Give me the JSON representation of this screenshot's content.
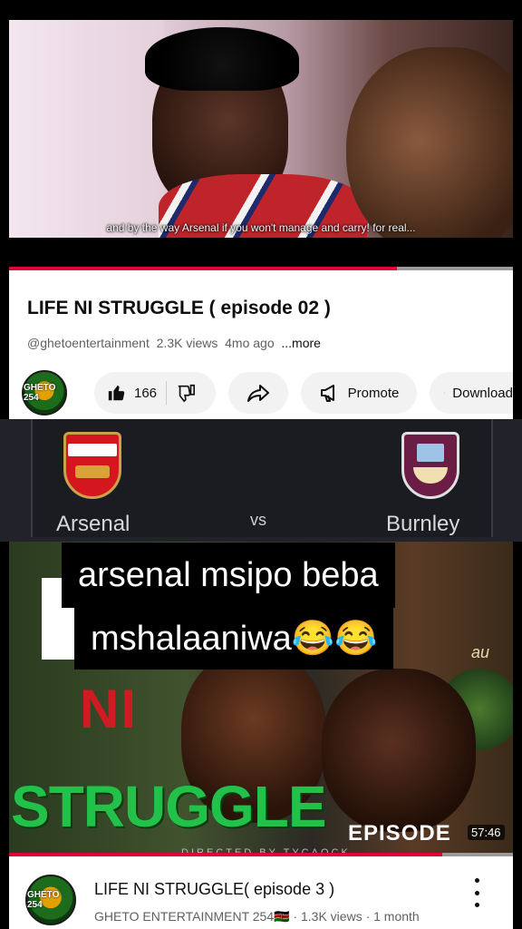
{
  "video_top": {
    "subtitle": "and by the way Arsenal if you won't manage and carry! for real..."
  },
  "video1": {
    "title": "LIFE NI STRUGGLE ( episode 02 )",
    "channel_handle": "@ghetoentertainment",
    "views": "2.3K views",
    "age": "4mo ago",
    "more": "...more",
    "channel_logo_text": "GHETO 254",
    "likes": "166",
    "promote_label": "Promote",
    "download_label": "Download",
    "progress": 0.77
  },
  "scoreboard": {
    "home_team": "Arsenal",
    "vs": "vs",
    "away_team": "Burnley"
  },
  "overlay": {
    "line1": "arsenal msipo beba",
    "line2": "mshalaaniwa😂😂"
  },
  "video2": {
    "thumb_title_l": "L",
    "thumb_title_ni": "NI",
    "thumb_title_struggle": "STRUGGLE",
    "thumb_episode": "EPISODE",
    "thumb_directed": "DIRECTED BY TYCAOCK",
    "thumb_side_text": "au",
    "duration": "57:46",
    "title": "LIFE NI STRUGGLE( episode 3 )",
    "meta": "GHETO ENTERTAINMENT 254🇰🇪 · 1.3K views · 1 month",
    "channel_logo_text": "GHETO 254",
    "progress": 0.86
  },
  "colors": {
    "progress_red": "#e0003c",
    "struggle_green": "#22c24a",
    "ni_red": "#d01a24"
  }
}
